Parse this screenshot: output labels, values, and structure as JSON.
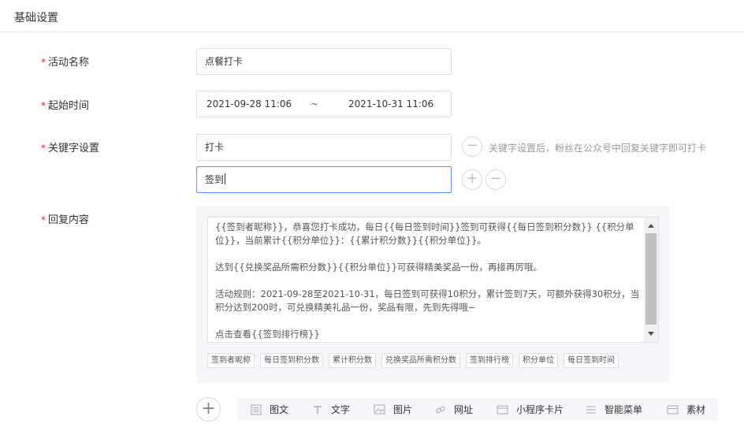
{
  "section": {
    "title": "基础设置"
  },
  "form": {
    "name": {
      "label": "活动名称",
      "value": "点餐打卡"
    },
    "time": {
      "label": "起始时间",
      "start": "2021-09-28 11:06",
      "separator": "~",
      "end": "2021-10-31 11:06"
    },
    "keywords": {
      "label": "关键字设置",
      "items": [
        "打卡",
        "签到"
      ],
      "hint": "关键字设置后，粉丝在公众号中回复关键字即可打卡",
      "remove_symbol": "−",
      "add_symbol": "+"
    },
    "reply": {
      "label": "回复内容",
      "paragraphs": [
        "{{签到者昵称}}，恭喜您打卡成功，每日{{每日签到时间}}签到可获得{{每日签到积分数}} {{积分单位}}，当前累计{{积分单位}}：{{累计积分数}}{{积分单位}}。",
        "达到{{兑换奖品所需积分数}}{{积分单位}}可获得精美奖品一份，再接再厉哦。",
        "活动规则：2021-09-28至2021-10-31，每日签到可获得10积分，累计签到7天，可额外获得30积分，当积分达到200时，可兑换精美礼品一份，奖品有限，先到先得哦~",
        "点击查看{{签到排行榜}}"
      ],
      "tags": [
        "签到者昵称",
        "每日签到积分数",
        "累计积分数",
        "兑换奖品所需积分数",
        "签到排行榜",
        "积分单位",
        "每日签到时间"
      ]
    }
  },
  "toolbar": {
    "add_symbol": "+",
    "items": [
      {
        "label": "图文",
        "icon": "article-icon"
      },
      {
        "label": "文字",
        "icon": "text-icon"
      },
      {
        "label": "图片",
        "icon": "image-icon"
      },
      {
        "label": "网址",
        "icon": "link-icon"
      },
      {
        "label": "小程序卡片",
        "icon": "miniprogram-card-icon"
      },
      {
        "label": "智能菜单",
        "icon": "menu-icon"
      },
      {
        "label": "素材",
        "icon": "material-icon"
      }
    ]
  },
  "colors": {
    "required": "#e02020",
    "focus_border": "#5b8ff9",
    "hint": "#999999",
    "panel_bg": "#f5f6f9"
  }
}
